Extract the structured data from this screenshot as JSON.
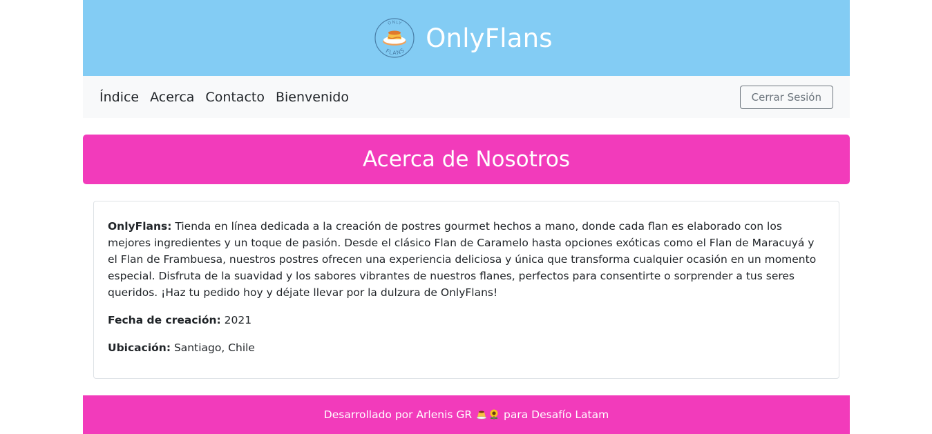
{
  "header": {
    "logo_top_text": "ONLY",
    "logo_bottom_text": "FLANS",
    "title": "OnlyFlans"
  },
  "nav": {
    "links": [
      {
        "label": "Índice"
      },
      {
        "label": "Acerca"
      },
      {
        "label": "Contacto"
      },
      {
        "label": "Bienvenido"
      }
    ],
    "logout_label": "Cerrar Sesión"
  },
  "banner": {
    "title": "Acerca de Nosotros"
  },
  "about": {
    "desc_label": "OnlyFlans:",
    "desc_text": " Tienda en línea dedicada a la creación de postres gourmet hechos a mano, donde cada flan es elaborado con los mejores ingredientes y un toque de pasión. Desde el clásico Flan de Caramelo hasta opciones exóticas como el Flan de Maracuyá y el Flan de Frambuesa, nuestros postres ofrecen una experiencia deliciosa y única que transforma cualquier ocasión en un momento especial. Disfruta de la suavidad y los sabores vibrantes de nuestros flanes, perfectos para consentirte o sorprender a tus seres queridos. ¡Haz tu pedido hoy y déjate llevar por la dulzura de OnlyFlans!",
    "date_label": "Fecha de creación:",
    "date_value": " 2021",
    "location_label": "Ubicación:",
    "location_value": " Santiago, Chile"
  },
  "footer": {
    "text_before": "Desarrollado por Arlenis GR ",
    "text_after": " para Desafío Latam"
  },
  "colors": {
    "header_bg": "#83ccf4",
    "accent_pink": "#f23bbb",
    "nav_bg": "#f8f9fa"
  },
  "icons": [
    "flan-logo-icon",
    "flan-emoji-icon",
    "sunflower-emoji-icon"
  ]
}
